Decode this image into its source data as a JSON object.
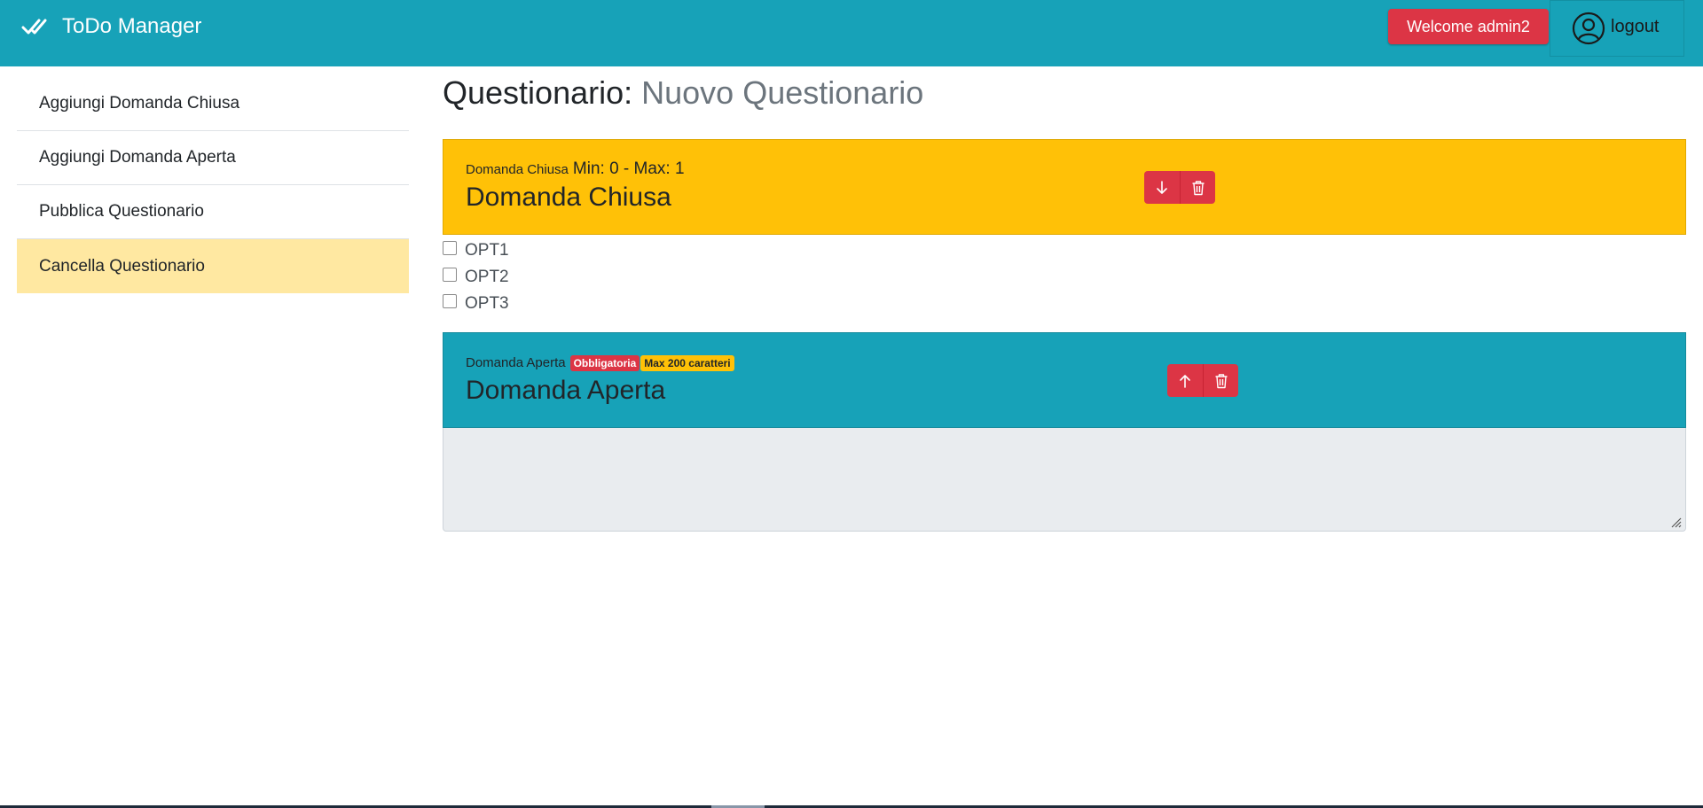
{
  "app": {
    "brand": "ToDo Manager",
    "welcome": "Welcome admin2",
    "logout": "logout"
  },
  "sidebar": {
    "items": [
      {
        "label": "Aggiungi Domanda Chiusa",
        "active": false
      },
      {
        "label": "Aggiungi Domanda Aperta",
        "active": false
      },
      {
        "label": "Pubblica Questionario",
        "active": false
      },
      {
        "label": "Cancella Questionario",
        "active": true
      }
    ]
  },
  "page": {
    "title_prefix": "Questionario:",
    "title_name": "Nuovo Questionario"
  },
  "questions": {
    "closed": {
      "type_label": "Domanda Chiusa",
      "range": "Min: 0 - Max: 1",
      "text": "Domanda Chiusa",
      "options": [
        "OPT1",
        "OPT2",
        "OPT3"
      ]
    },
    "open": {
      "type_label": "Domanda Aperta",
      "badge_required": "Obbligatoria",
      "badge_max": "Max 200 caratteri",
      "text": "Domanda Aperta",
      "answer": ""
    }
  },
  "colors": {
    "navbar": "#17a2b8",
    "danger": "#dc3545",
    "warning": "#ffc107",
    "active_item": "#ffe8a1"
  },
  "icons": {
    "brand": "double-check-icon",
    "user": "user-circle-icon",
    "move_down": "arrow-down-icon",
    "move_up": "arrow-up-icon",
    "delete": "trash-icon"
  }
}
